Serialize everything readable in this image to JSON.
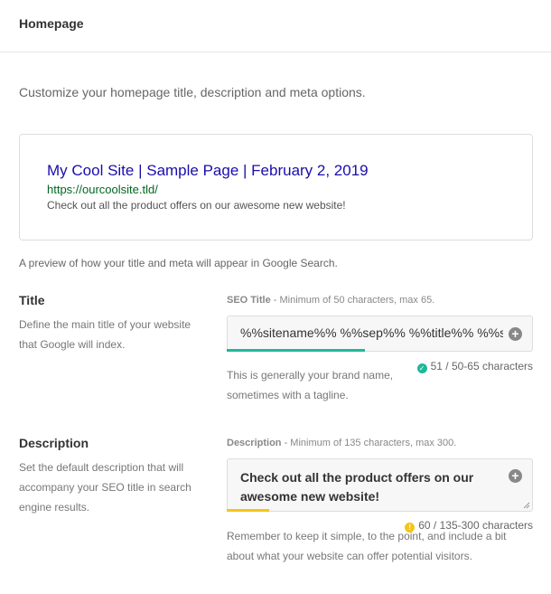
{
  "header": {
    "title": "Homepage"
  },
  "intro": "Customize your homepage title, description and meta options.",
  "preview": {
    "title": "My Cool Site | Sample Page | February 2, 2019",
    "url": "https://ourcoolsite.tld/",
    "description": "Check out all the product offers on our awesome new website!",
    "caption": "A preview of how your title and meta will appear in Google Search."
  },
  "title_section": {
    "heading": "Title",
    "description": "Define the main title of your website that Google will index.",
    "field_label": "SEO Title",
    "field_hint": " - Minimum of 50 characters, max 65.",
    "value": "%%sitename%% %%sep%% %%title%% %%sep%%",
    "help": "This is generally your brand name, sometimes with a tagline.",
    "counter": "51 / 50-65 characters",
    "progress_fraction": 0.45,
    "status_color": "#1fb89a"
  },
  "description_section": {
    "heading": "Description",
    "description": "Set the default description that will accompany your SEO title in search engine results.",
    "field_label": "Description",
    "field_hint": " - Minimum of 135 characters, max 300.",
    "value": "Check out all the product offers on our awesome new website!",
    "help": "Remember to keep it simple, to the point, and include a bit about what your website can offer potential visitors.",
    "counter": "60 / 135-300 characters",
    "progress_fraction": 0.14,
    "status_color": "#f5c518"
  },
  "icons": {
    "plus": "plus-circle-icon",
    "check": "check-circle-icon",
    "warning": "warning-circle-icon"
  }
}
